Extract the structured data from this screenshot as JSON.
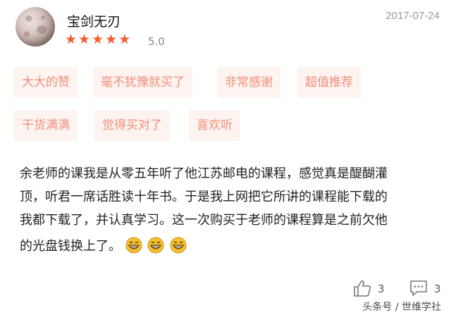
{
  "user": {
    "name": "宝剑无刃",
    "date": "2017-07-24"
  },
  "rating": {
    "stars": 5,
    "max_stars": 5,
    "score": "5.0"
  },
  "tags": [
    {
      "label": "大大的赞"
    },
    {
      "label": "毫不犹豫就买了"
    },
    {
      "label": "非常感谢"
    },
    {
      "label": "超值推荐"
    },
    {
      "label": "干货满满"
    },
    {
      "label": "觉得买对了"
    },
    {
      "label": "喜欢听"
    }
  ],
  "review": {
    "lines": [
      "余老师的课我是从零五年听了他江苏邮电的课程，感觉真是醍醐灌",
      "顶，听君一席话胜读十年书。于是我上网把它所讲的课程能下载的",
      "我都下载了，并认真学习。这一次购买于老师的课程算是之前欠他",
      "的光盘钱换上了。"
    ],
    "emoji": [
      "grinning-face-icon",
      "grinning-face-icon",
      "grinning-face-icon"
    ]
  },
  "footer": {
    "likes": "3",
    "comments": "3"
  },
  "watermark": "头条号 / 世维学社",
  "colors": {
    "star": "#f0612f",
    "tag_bg": "#fdf3f0",
    "tag_text": "#f08f79"
  }
}
